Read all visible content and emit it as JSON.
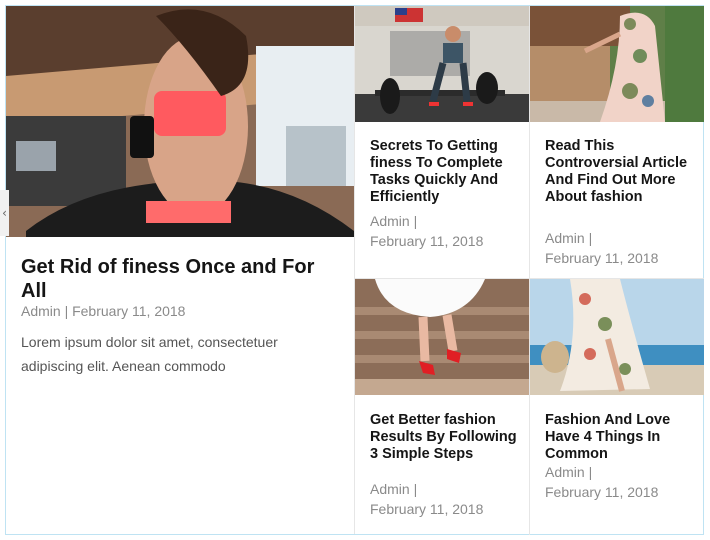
{
  "navigation": {
    "prev_arrow": "‹"
  },
  "featured": {
    "title": "Get Rid of finess Once and For All",
    "meta": "Admin | February 11, 2018",
    "excerpt": "Lorem ipsum dolor sit amet, consectetuer adipiscing elit. Aenean commodo",
    "image_subject": "woman running on treadmill in gym"
  },
  "posts": [
    {
      "title": "Secrets To Getting finess To Complete Tasks Quickly And Efficiently",
      "author": "Admin |",
      "date": "February 11, 2018",
      "image_subject": "man lifting barbell in gym"
    },
    {
      "title": "Read This Controversial Article And Find Out More About fashion",
      "author": "Admin |",
      "date": "February 11, 2018",
      "image_subject": "woman in floral dress outdoors"
    },
    {
      "title": "Get Better fashion Results By Following 3 Simple Steps",
      "author": "Admin |",
      "date": "February 11, 2018",
      "image_subject": "legs in white skirt and red heels on steps"
    },
    {
      "title": "Fashion And Love Have 4 Things In Common",
      "author": "Admin |",
      "date": "February 11, 2018",
      "image_subject": "woman in floral dress at the beach"
    }
  ],
  "colors": {
    "frame_border": "#bfe3f3",
    "title": "#151515",
    "meta": "#8a8a8a"
  }
}
